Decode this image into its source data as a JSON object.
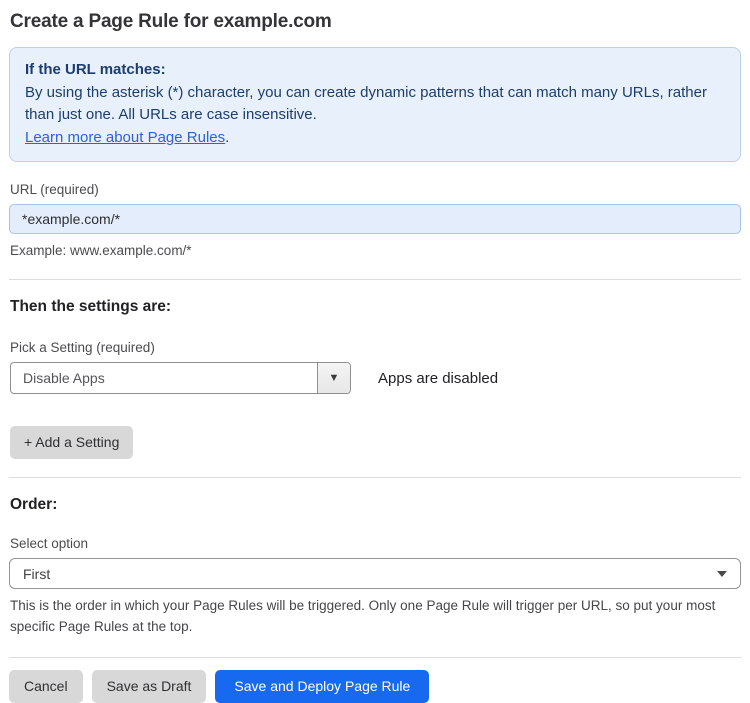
{
  "page": {
    "title": "Create a Page Rule for example.com"
  },
  "info_box": {
    "heading": "If the URL matches:",
    "body": "By using the asterisk (*) character, you can create dynamic patterns that can match many URLs, rather than just one. All URLs are case insensitive.",
    "link_label": "Learn more about Page Rules",
    "link_suffix": "."
  },
  "url_field": {
    "label": "URL (required)",
    "value": "*example.com/*",
    "example": "Example: www.example.com/*"
  },
  "settings_section": {
    "heading": "Then the settings are:",
    "picker_label": "Pick a Setting (required)",
    "picker_value": "Disable Apps",
    "status_text": "Apps are disabled",
    "add_button_label": "+ Add a Setting"
  },
  "order_section": {
    "heading": "Order:",
    "select_label": "Select option",
    "select_value": "First",
    "help_text": "This is the order in which your Page Rules will be triggered. Only one Page Rule will trigger per URL, so put your most specific Page Rules at the top."
  },
  "footer": {
    "cancel_label": "Cancel",
    "save_draft_label": "Save as Draft",
    "save_deploy_label": "Save and Deploy Page Rule"
  },
  "icons": {
    "dropdown_caret": "▼"
  },
  "colors": {
    "info_bg": "#e8f1fb",
    "info_border": "#b7d2ee",
    "info_text": "#1c3d6e",
    "link_blue": "#2a62d9",
    "input_bg": "#e3edfb",
    "input_border": "#a5c3e4",
    "label_gray": "#4c4c4f",
    "primary_blue": "#1769f0",
    "gray_button": "#d8d8d8"
  }
}
